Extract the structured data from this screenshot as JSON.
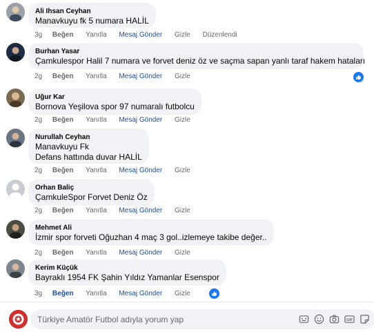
{
  "comments": [
    {
      "author": "Ali Ihsan Ceyhan",
      "lines": [
        "Manavkuyu fk 5 numara HALİL"
      ],
      "time": "3g",
      "like": "Beğen",
      "reply": "Yanıtla",
      "message": "Mesaj Gönder",
      "hide": "Gizle",
      "edited": "Düzenlendi",
      "avatar_color": "#8a8f99"
    },
    {
      "author": "Burhan Yasar",
      "lines": [
        "Çamkulespor Halil 7 numara ve forvet deniz öz ve saçma sapan yanlı taraf hakem hataları"
      ],
      "time": "2g",
      "like": "Beğen",
      "reply": "Yanıtla",
      "message": "Mesaj Gönder",
      "hide": "Gizle",
      "reaction_icon": "like-reaction-icon",
      "avatar_color": "#2b3a55"
    },
    {
      "author": "Uğur Kar",
      "lines": [
        "Bornova Yeşilova spor 97 numaralı futbolcu"
      ],
      "time": "2g",
      "like": "Beğen",
      "reply": "Yanıtla",
      "message": "Mesaj Gönder",
      "hide": "Gizle",
      "avatar_color": "#6b5a3e"
    },
    {
      "author": "Nurullah Ceyhan",
      "lines": [
        "Manavkuyu Fk",
        "Defans hattında duvar HALİL"
      ],
      "time": "2g",
      "like": "Beğen",
      "reply": "Yanıtla",
      "message": "Mesaj Gönder",
      "hide": "Gizle",
      "avatar_color": "#5f6b7a"
    },
    {
      "author": "Orhan Baliç",
      "lines": [
        "ÇamkuleSpor Forvet Deniz Öz"
      ],
      "time": "2g",
      "like": "Beğen",
      "reply": "Yanıtla",
      "message": "Mesaj Gönder",
      "hide": "Gizle",
      "avatar_color": "#b8bcc2"
    },
    {
      "author": "Mehmet Ali",
      "lines": [
        "İzmir spor forveti Oğuzhan 4 maç 3 gol..izlemeye takibe değer.."
      ],
      "time": "2g",
      "like": "Beğen",
      "reply": "Yanıtla",
      "message": "Mesaj Gönder",
      "hide": "Gizle",
      "avatar_color": "#3d3f35"
    },
    {
      "author": "Kerim Küçük",
      "lines": [
        "Bayraklı 1954 FK Şahin Yıldız Yamanlar Esenspor"
      ],
      "time": "3g",
      "like": "Beğen",
      "reply": "Yanıtla",
      "message": "Mesaj Gönder",
      "hide": "Gizle",
      "reaction_icon": "like-reaction-icon",
      "liked": true,
      "avatar_color": "#6f7880"
    }
  ],
  "composer": {
    "placeholder": "Türkiye Amatör Futbol adıyla yorum yap",
    "icons": [
      "emoji-icon",
      "sticker-icon",
      "camera-icon",
      "gif-icon",
      "sticker-pack-icon"
    ]
  },
  "colors": {
    "link_blue": "#1b4fa0",
    "fb_blue": "#1877f2",
    "muted": "#65676b",
    "bubble": "#f0f2f5"
  }
}
